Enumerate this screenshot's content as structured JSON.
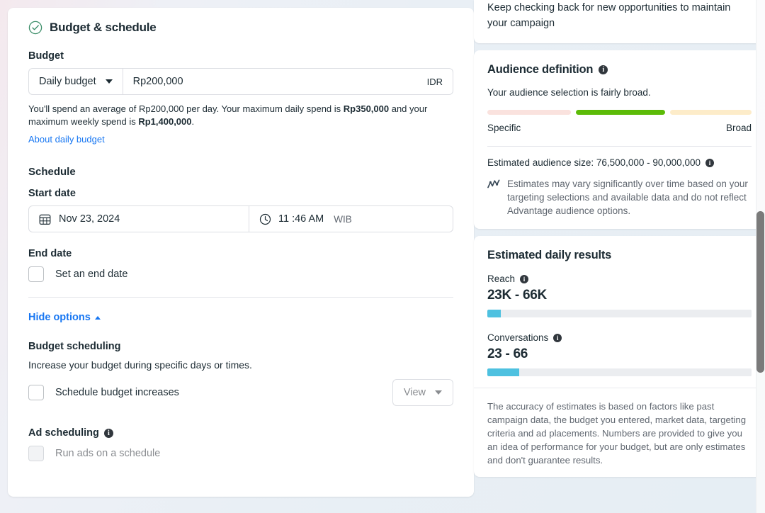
{
  "left": {
    "card_title": "Budget & schedule",
    "check_icon": "check-circle-icon",
    "budget": {
      "label": "Budget",
      "type_selected": "Daily budget",
      "amount_value": "Rp200,000",
      "currency": "IDR",
      "helper_prefix": "You'll spend an average of Rp200,000 per day. Your maximum daily spend is ",
      "helper_max_daily": "Rp350,000",
      "helper_mid": " and your maximum weekly spend is ",
      "helper_max_weekly": "Rp1,400,000",
      "helper_suffix": ".",
      "about_link": "About daily budget"
    },
    "schedule": {
      "heading": "Schedule",
      "start_label": "Start date",
      "start_date": "Nov 23, 2024",
      "start_time": "11 :46 AM",
      "timezone": "WIB",
      "end_label": "End date",
      "end_checkbox_label": "Set an end date",
      "calendar_icon": "calendar-icon",
      "clock_icon": "clock-icon"
    },
    "hide_options": "Hide options",
    "budget_scheduling": {
      "heading": "Budget scheduling",
      "description": "Increase your budget during specific days or times.",
      "checkbox_label": "Schedule budget increases",
      "view_button": "View"
    },
    "ad_scheduling": {
      "heading": "Ad scheduling",
      "checkbox_label": "Run ads on a schedule"
    }
  },
  "right": {
    "top_note": "Keep checking back for new opportunities to maintain your campaign",
    "audience": {
      "title": "Audience definition",
      "description": "Your audience selection is fairly broad.",
      "label_specific": "Specific",
      "label_broad": "Broad",
      "size_text": "Estimated audience size: 76,500,000 - 90,000,000",
      "estimate_note": "Estimates may vary significantly over time based on your targeting selections and available data and do not reflect Advantage audience options.",
      "meter_colors": [
        "#fae2de",
        "#5cbb08",
        "#fdecc9"
      ],
      "meter_widths": [
        31,
        33,
        30
      ],
      "chart_icon": "trend-chart-icon"
    },
    "daily_results": {
      "title": "Estimated daily results",
      "metrics": [
        {
          "label": "Reach",
          "value": "23K - 66K",
          "fill_pct": 5
        },
        {
          "label": "Conversations",
          "value": "23 - 66",
          "fill_pct": 12
        }
      ],
      "bar_color": "#4ec1e0",
      "accuracy_text": "The accuracy of estimates is based on factors like past campaign data, the budget you entered, market data, targeting criteria and ad placements. Numbers are provided to give you an idea of performance for your budget, but are only estimates and don't guarantee results."
    }
  }
}
